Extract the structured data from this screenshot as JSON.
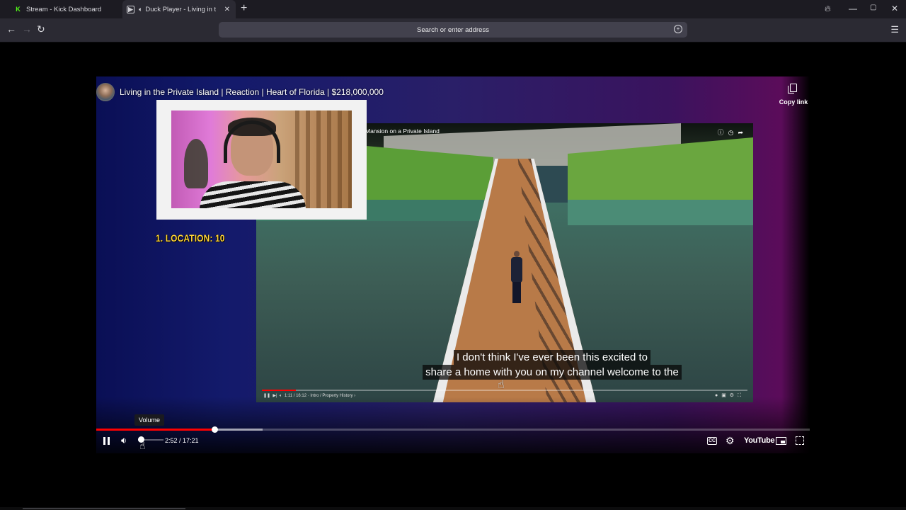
{
  "browser": {
    "tabs": [
      {
        "label": "Stream - Kick Dashboard",
        "favicon": "kick-icon"
      },
      {
        "label": "Duck Player - Living in the",
        "favicon": "duck-player-icon",
        "audio": "speaker-icon",
        "active": true
      }
    ],
    "new_tab_glyph": "+",
    "address_placeholder": "Search or enter address",
    "window_controls": [
      "—",
      "▢",
      "✕"
    ]
  },
  "player": {
    "title": "Living in the Private Island | Reaction | Heart of Florida | $218,000,000",
    "copy_link_label": "Copy link",
    "overlay_label": "1. LOCATION: 10",
    "inner_video": {
      "title": "Mansion on a Private Island",
      "controls_text": "1:11 / 16:12 · Intro / Property History ›",
      "progress": 0.07
    },
    "captions": [
      "I don't think I've ever been this excited to",
      "share a home with you on my channel welcome to the"
    ],
    "time": "2:52 / 17:21",
    "progress_played": 0.166,
    "progress_buffered": 0.233,
    "volume": 0.15,
    "tooltip": "Volume",
    "youtube_label": "YouTube",
    "accent_color": "#ff0000"
  }
}
